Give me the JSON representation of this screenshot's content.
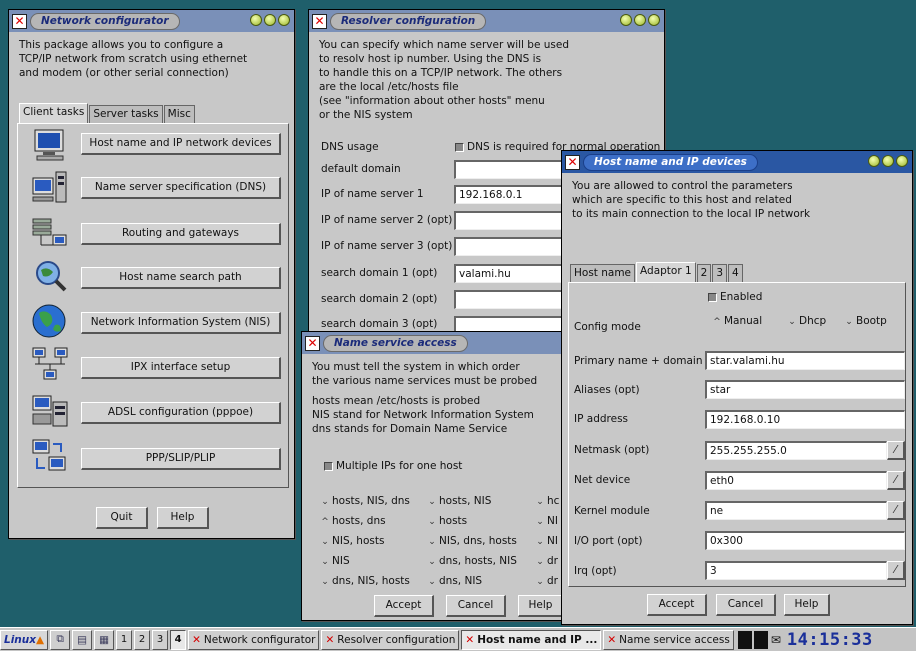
{
  "network_configurator": {
    "title": "Network configurator",
    "intro": "This package allows you to configure a\nTCP/IP network from scratch using ethernet\nand modem (or other serial connection)",
    "tabs": [
      "Client tasks",
      "Server tasks",
      "Misc"
    ],
    "tasks": [
      {
        "label": "Host name and IP network devices",
        "icon": "monitor-icon"
      },
      {
        "label": "Name server specification (DNS)",
        "icon": "server-tower-icon"
      },
      {
        "label": "Routing and gateways",
        "icon": "router-network-icon"
      },
      {
        "label": "Host name search path",
        "icon": "magnifier-globe-icon"
      },
      {
        "label": "Network Information System (NIS)",
        "icon": "globe-icon"
      },
      {
        "label": "IPX interface setup",
        "icon": "ipx-network-icon"
      },
      {
        "label": "ADSL configuration (pppoe)",
        "icon": "adsl-modem-icon"
      },
      {
        "label": "PPP/SLIP/PLIP",
        "icon": "serial-link-icon"
      }
    ],
    "quit_label": "Quit",
    "help_label": "Help"
  },
  "resolver": {
    "title": "Resolver configuration",
    "intro": "You can specify which name server will be used\nto resolv host ip number. Using the DNS is\nto handle this on a TCP/IP network. The others\nare the local /etc/hosts file\n   (see \"information about other hosts\" menu\nor the NIS system",
    "dns_usage_label": "DNS usage",
    "dns_required_label": "DNS is required for normal operation",
    "fields": [
      {
        "label": "default domain",
        "value": ""
      },
      {
        "label": "IP of name server 1",
        "value": "192.168.0.1"
      },
      {
        "label": "IP of name server 2 (opt)",
        "value": ""
      },
      {
        "label": "IP of name server 3 (opt)",
        "value": ""
      },
      {
        "label": "search domain 1 (opt)",
        "value": "valami.hu"
      },
      {
        "label": "search domain 2 (opt)",
        "value": ""
      },
      {
        "label": "search domain 3 (opt)",
        "value": ""
      }
    ]
  },
  "name_service": {
    "title": "Name service access",
    "intro": "You must tell the system in which order\nthe various name services must be probed",
    "notes": "hosts mean /etc/hosts is probed\nNIS stand for Network Information System\ndns stands for Domain Name Service",
    "multiple_ips_label": "Multiple IPs for one host",
    "options_col1": [
      "hosts, NIS, dns",
      "hosts, dns",
      "NIS, hosts",
      "NIS",
      "dns, NIS, hosts"
    ],
    "options_col2": [
      "hosts, NIS",
      "hosts",
      "NIS, dns, hosts",
      "dns, hosts, NIS",
      "dns, NIS"
    ],
    "options_col3": [
      "hc",
      "NI",
      "NI",
      "dr",
      "dr"
    ],
    "selected": "hosts, dns",
    "accept_label": "Accept",
    "cancel_label": "Cancel",
    "help_label": "Help"
  },
  "host_ip": {
    "title": "Host name and IP devices",
    "intro": "You are allowed to control the parameters\nwhich are specific to this host and related\nto its main connection to the local IP network",
    "tabs": [
      "Host name",
      "Adaptor 1",
      "2",
      "3",
      "4"
    ],
    "enabled_label": "Enabled",
    "config_mode_label": "Config mode",
    "modes": [
      "Manual",
      "Dhcp",
      "Bootp"
    ],
    "selected_mode": "Manual",
    "fields": [
      {
        "label": "Primary name + domain",
        "value": "star.valami.hu"
      },
      {
        "label": "Aliases (opt)",
        "value": "star"
      },
      {
        "label": "IP address",
        "value": "192.168.0.10"
      },
      {
        "label": "Netmask (opt)",
        "value": "255.255.255.0"
      },
      {
        "label": "Net device",
        "value": "eth0"
      },
      {
        "label": "Kernel module",
        "value": "ne"
      },
      {
        "label": "I/O port (opt)",
        "value": "0x300"
      },
      {
        "label": "Irq (opt)",
        "value": "3"
      }
    ],
    "accept_label": "Accept",
    "cancel_label": "Cancel",
    "help_label": "Help"
  },
  "taskbar": {
    "logo": "Linux",
    "desktops": [
      "1",
      "2",
      "3",
      "4"
    ],
    "active_desktop": "4",
    "windows": [
      "Network configurator",
      "Resolver configuration",
      "Host name and IP ...",
      "Name service access"
    ],
    "active_window": "Host name and IP ...",
    "clock": "14:15:33"
  }
}
